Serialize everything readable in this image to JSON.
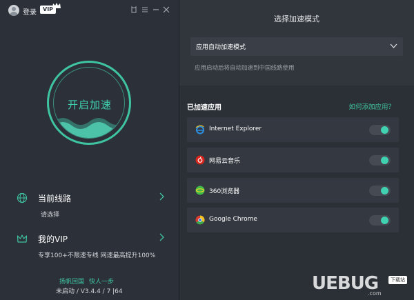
{
  "titlebar": {
    "login_label": "登录",
    "vip_badge": "VIP"
  },
  "accelerate": {
    "button_label": "开启加速"
  },
  "route": {
    "title": "当前线路",
    "subtitle": "请选择"
  },
  "vip": {
    "title": "我的VIP",
    "subtitle": "专享100+不限速专线 网速最高提升100%"
  },
  "footer": {
    "link1": "扬帆回国",
    "link2": "快人一步",
    "version": "未启动 / V3.4.4 / 7 |64"
  },
  "mode": {
    "title": "选择加速模式",
    "selected": "应用自动加速模式",
    "description": "应用启动后将自动加速到中国线路使用"
  },
  "apps": {
    "title": "已加速应用",
    "add_link": "如何添加应用？",
    "items": [
      {
        "name": "Internet Explorer",
        "icon": "internet-explorer-icon",
        "enabled": true
      },
      {
        "name": "网易云音乐",
        "icon": "netease-music-icon",
        "enabled": true
      },
      {
        "name": "360浏览器",
        "icon": "360-browser-icon",
        "enabled": true
      },
      {
        "name": "Google Chrome",
        "icon": "chrome-icon",
        "enabled": true
      }
    ]
  },
  "watermark": {
    "text": "UEBUG",
    "badge": "下载站",
    "url": ".com"
  },
  "colors": {
    "accent": "#3fc4a2",
    "panel_left": "#2c3038",
    "panel_right_top": "#31353c",
    "row_bg": "#343840"
  }
}
